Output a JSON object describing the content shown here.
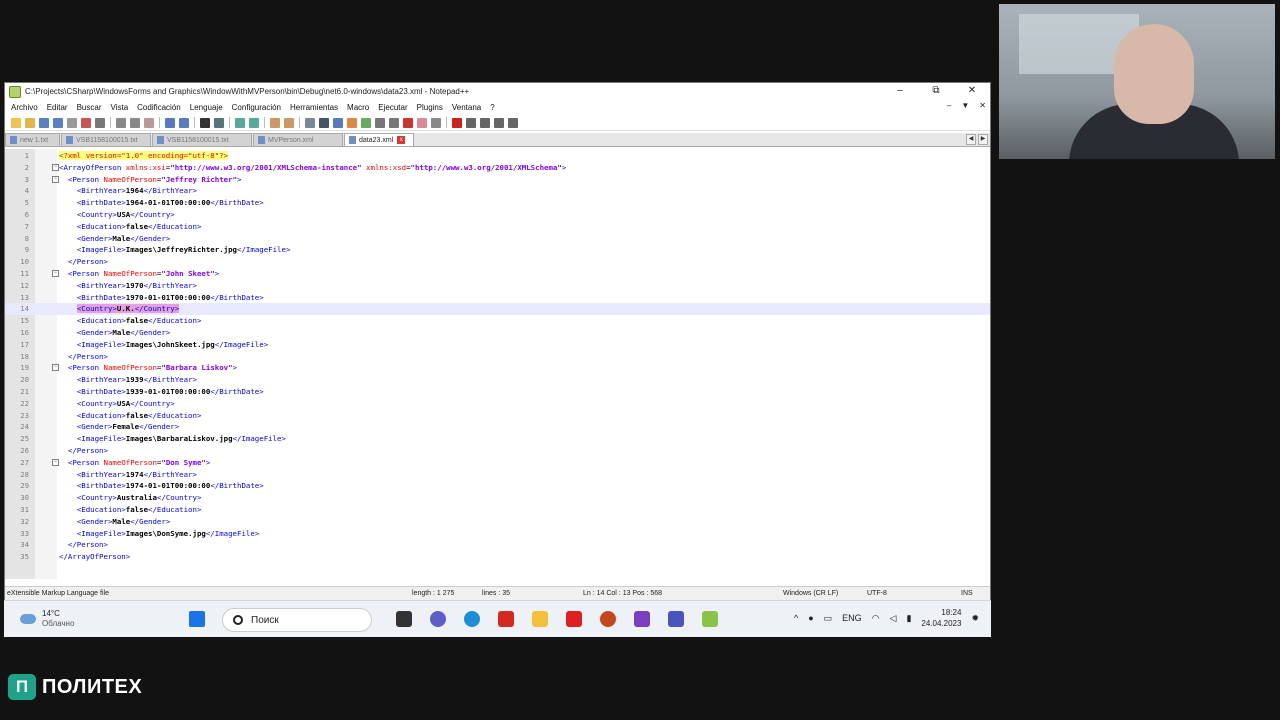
{
  "window": {
    "title": "C:\\Projects\\CSharp\\WindowsForms and Graphics\\WindowWithMVPerson\\bin\\Debug\\net6.0-windows\\data23.xml - Notepad++",
    "min": "–",
    "max": "⧉",
    "close": "✕"
  },
  "menu": {
    "items": [
      "Archivo",
      "Editar",
      "Buscar",
      "Vista",
      "Codificación",
      "Lenguaje",
      "Configuración",
      "Herramientas",
      "Macro",
      "Ejecutar",
      "Plugins",
      "Ventana",
      "?"
    ],
    "mdi_min": "–",
    "mdi_down": "▼",
    "mdi_close": "✕"
  },
  "tabs": [
    {
      "label": "new 1.txt",
      "active": false
    },
    {
      "label": "VSB1158100015.txt",
      "active": false
    },
    {
      "label": "VSB1158100015.txt",
      "active": false
    },
    {
      "label": "MVPerson.xml",
      "active": false
    },
    {
      "label": "data23.xml",
      "active": true
    }
  ],
  "editor": {
    "lines": [
      "<?xml version=\"1.0\" encoding=\"utf-8\"?>",
      "<ArrayOfPerson xmlns:xsi=\"http://www.w3.org/2001/XMLSchema-instance\" xmlns:xsd=\"http://www.w3.org/2001/XMLSchema\">",
      "  <Person NameOfPerson=\"Jeffrey Richter\">",
      "    <BirthYear>1964</BirthYear>",
      "    <BirthDate>1964-01-01T00:00:00</BirthDate>",
      "    <Country>USA</Country>",
      "    <Education>false</Education>",
      "    <Gender>Male</Gender>",
      "    <ImageFile>Images\\JeffreyRichter.jpg</ImageFile>",
      "  </Person>",
      "  <Person NameOfPerson=\"John Skeet\">",
      "    <BirthYear>1970</BirthYear>",
      "    <BirthDate>1970-01-01T00:00:00</BirthDate>",
      "    <Country>U.K.</Country>",
      "    <Education>false</Education>",
      "    <Gender>Male</Gender>",
      "    <ImageFile>Images\\JohnSkeet.jpg</ImageFile>",
      "  </Person>",
      "  <Person NameOfPerson=\"Barbara Liskov\">",
      "    <BirthYear>1939</BirthYear>",
      "    <BirthDate>1939-01-01T00:00:00</BirthDate>",
      "    <Country>USA</Country>",
      "    <Education>false</Education>",
      "    <Gender>Female</Gender>",
      "    <ImageFile>Images\\BarbaraLiskov.jpg</ImageFile>",
      "  </Person>",
      "  <Person NameOfPerson=\"Don Syme\">",
      "    <BirthYear>1974</BirthYear>",
      "    <BirthDate>1974-01-01T00:00:00</BirthDate>",
      "    <Country>Australia</Country>",
      "    <Education>false</Education>",
      "    <Gender>Male</Gender>",
      "    <ImageFile>Images\\DonSyme.jpg</ImageFile>",
      "  </Person>",
      "</ArrayOfPerson>"
    ],
    "current_line": 14,
    "fold_lines": [
      2,
      3,
      11,
      19,
      27
    ]
  },
  "status": {
    "filetype": "eXtensible Markup Language file",
    "length": "length : 1 275",
    "lines": "lines : 35",
    "position": "Ln : 14    Col : 13    Pos : 568",
    "eol": "Windows (CR LF)",
    "encoding": "UTF-8",
    "mode": "INS"
  },
  "taskbar": {
    "temperature": "14°C",
    "weather": "Облачно",
    "search_placeholder": "Поиск",
    "language": "ENG",
    "time": "18:24",
    "date": "24.04.2023",
    "tray_up": "^"
  },
  "logo": {
    "mark": "П",
    "name": "ПОЛИТЕХ"
  },
  "colors": {
    "tag": "#0000ff",
    "attribute": "#ff0000",
    "value": "#8000ff",
    "selection": "#e5a0e0",
    "current_line": "#e8e8ff"
  }
}
